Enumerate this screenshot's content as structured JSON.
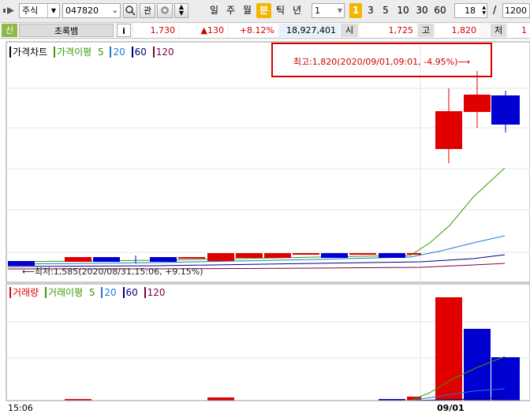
{
  "toolbar": {
    "market": "주식",
    "code": "047820",
    "btn_gwan": "관",
    "periods": [
      "일",
      "주",
      "월",
      "분",
      "틱",
      "년"
    ],
    "active_period": "분",
    "minute_value": "1",
    "minute_quick": [
      "1",
      "3",
      "5",
      "10",
      "30",
      "60"
    ],
    "active_minute": "1",
    "page_current": "18",
    "page_sep": "/",
    "page_total": "1200"
  },
  "info": {
    "badge": "신",
    "name": "초록뱀",
    "info_button": "i",
    "price": "1,730",
    "change": "▲130",
    "change_pct": "+8.12%",
    "volume": "18,927,401",
    "open_label": "시",
    "open": "1,725",
    "high_label": "고",
    "high": "1,820",
    "low_label": "저",
    "low": "1"
  },
  "price_legend": {
    "title": "가격차트",
    "ma_title": "가격이평",
    "ma_items": [
      "5",
      "20",
      "60",
      "120"
    ]
  },
  "volume_legend": {
    "title": "거래량",
    "ma_title": "거래이평",
    "ma_items": [
      "5",
      "20",
      "60",
      "120"
    ]
  },
  "annotations": {
    "high": "최고:1,820(2020/09/01,09:01, -4.95%)⟶",
    "low": "⟵최저:1,585(2020/08/31,15:06, +9.15%)"
  },
  "xaxis": {
    "left_label": "15:06",
    "date_label": "09/01"
  },
  "colors": {
    "up": "#e00000",
    "down": "#0000d0",
    "ma5": "#3a9a00",
    "ma20": "#1a7ad8",
    "ma60": "#00007a",
    "ma120": "#7a0040"
  }
}
